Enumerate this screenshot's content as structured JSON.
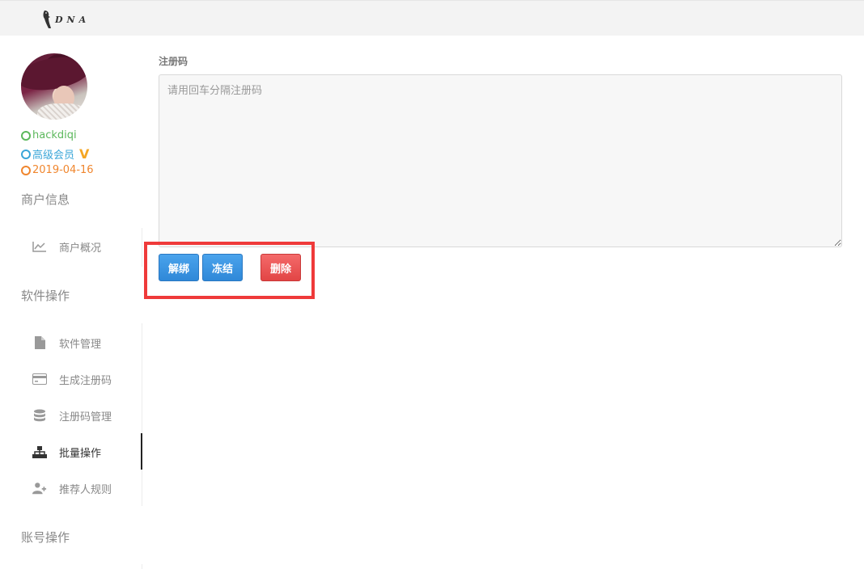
{
  "brand": {
    "logo_text": "DNA"
  },
  "user": {
    "name": "hackdiqi",
    "level": "高级会员",
    "vip_badge": "V",
    "date": "2019-04-16"
  },
  "sidebar": {
    "sections": [
      {
        "title": "商户信息",
        "items": [
          {
            "label": "商户概况",
            "icon": "line-chart-icon"
          }
        ]
      },
      {
        "title": "软件操作",
        "items": [
          {
            "label": "软件管理",
            "icon": "file-icon"
          },
          {
            "label": "生成注册码",
            "icon": "credit-card-icon"
          },
          {
            "label": "注册码管理",
            "icon": "database-icon"
          },
          {
            "label": "批量操作",
            "icon": "sitemap-icon",
            "active": true
          },
          {
            "label": "推荐人规则",
            "icon": "user-plus-icon"
          }
        ]
      },
      {
        "title": "账号操作",
        "items": []
      }
    ]
  },
  "main": {
    "field_label": "注册码",
    "textarea_value": "",
    "textarea_placeholder": "请用回车分隔注册码",
    "buttons": {
      "unbind": "解绑",
      "freeze": "冻结",
      "delete": "删除"
    }
  },
  "colors": {
    "primary": "#2f88d8",
    "danger": "#e24545",
    "highlight": "#ef3a3a"
  }
}
